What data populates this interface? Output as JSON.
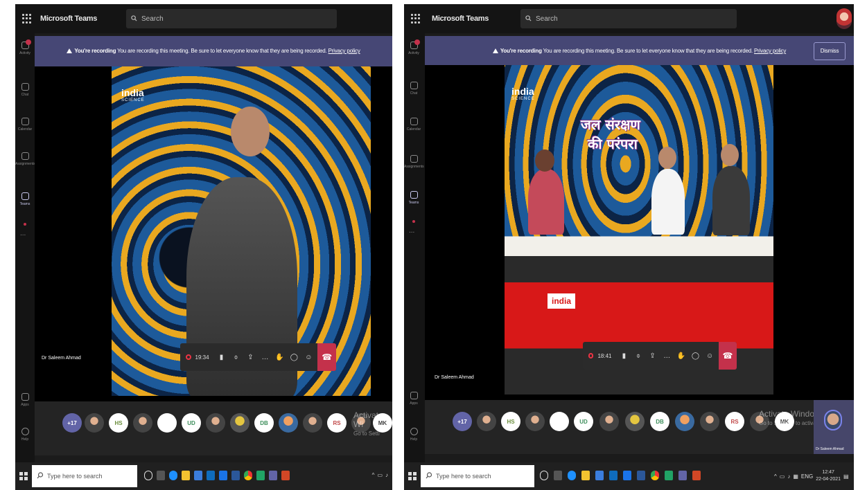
{
  "left": {
    "app_title": "Microsoft Teams",
    "search_placeholder": "Search",
    "rail": [
      "Activity",
      "Chat",
      "Calendar",
      "Assignments",
      "Teams",
      "Apps",
      "Help"
    ],
    "more": "...",
    "banner": {
      "bold": "You're recording",
      "text": "You are recording this meeting. Be sure to let everyone know that they are being recorded.",
      "link": "Privacy policy"
    },
    "video_logo": "india",
    "video_logo_sub": "SCIENCE",
    "controls": {
      "time": "19:34"
    },
    "speaker_name": "Dr Saleem Ahmad",
    "participants": [
      "+17",
      "",
      "HS",
      "",
      "",
      "UD",
      "",
      "",
      "DB",
      "",
      "",
      "RS",
      "",
      "MK"
    ],
    "watermark": {
      "line1": "Activate Wi",
      "line2": "Go to Setti"
    },
    "taskbar_search": "Type here to search"
  },
  "right": {
    "app_title": "Microsoft Teams",
    "search_placeholder": "Search",
    "rail": [
      "Activity",
      "Chat",
      "Calendar",
      "Assignments",
      "Teams",
      "Apps",
      "Help"
    ],
    "more": "...",
    "banner": {
      "bold": "You're recording",
      "text": "You are recording this meeting. Be sure to let everyone know that they are being recorded.",
      "link": "Privacy policy",
      "dismiss": "Dismiss"
    },
    "video_logo": "india",
    "video_logo_sub": "SCIENCE",
    "hindi_title_1": "जल संरक्षण",
    "hindi_title_2": "की परंपरा",
    "controls": {
      "time": "18:41"
    },
    "speaker_name": "Dr Saleem Ahmad",
    "participants": [
      "+17",
      "",
      "HS",
      "",
      "",
      "UD",
      "",
      "",
      "DB",
      "",
      "",
      "RS",
      "",
      "MK"
    ],
    "self_name": "Dr Saleem Ahmad",
    "watermark": {
      "line1": "Activate Windows",
      "line2": "Go to Settings to activate Windows."
    },
    "taskbar_search": "Type here to search",
    "lang": "ENG",
    "clock_time": "12:47",
    "clock_date": "22-04-2021"
  }
}
